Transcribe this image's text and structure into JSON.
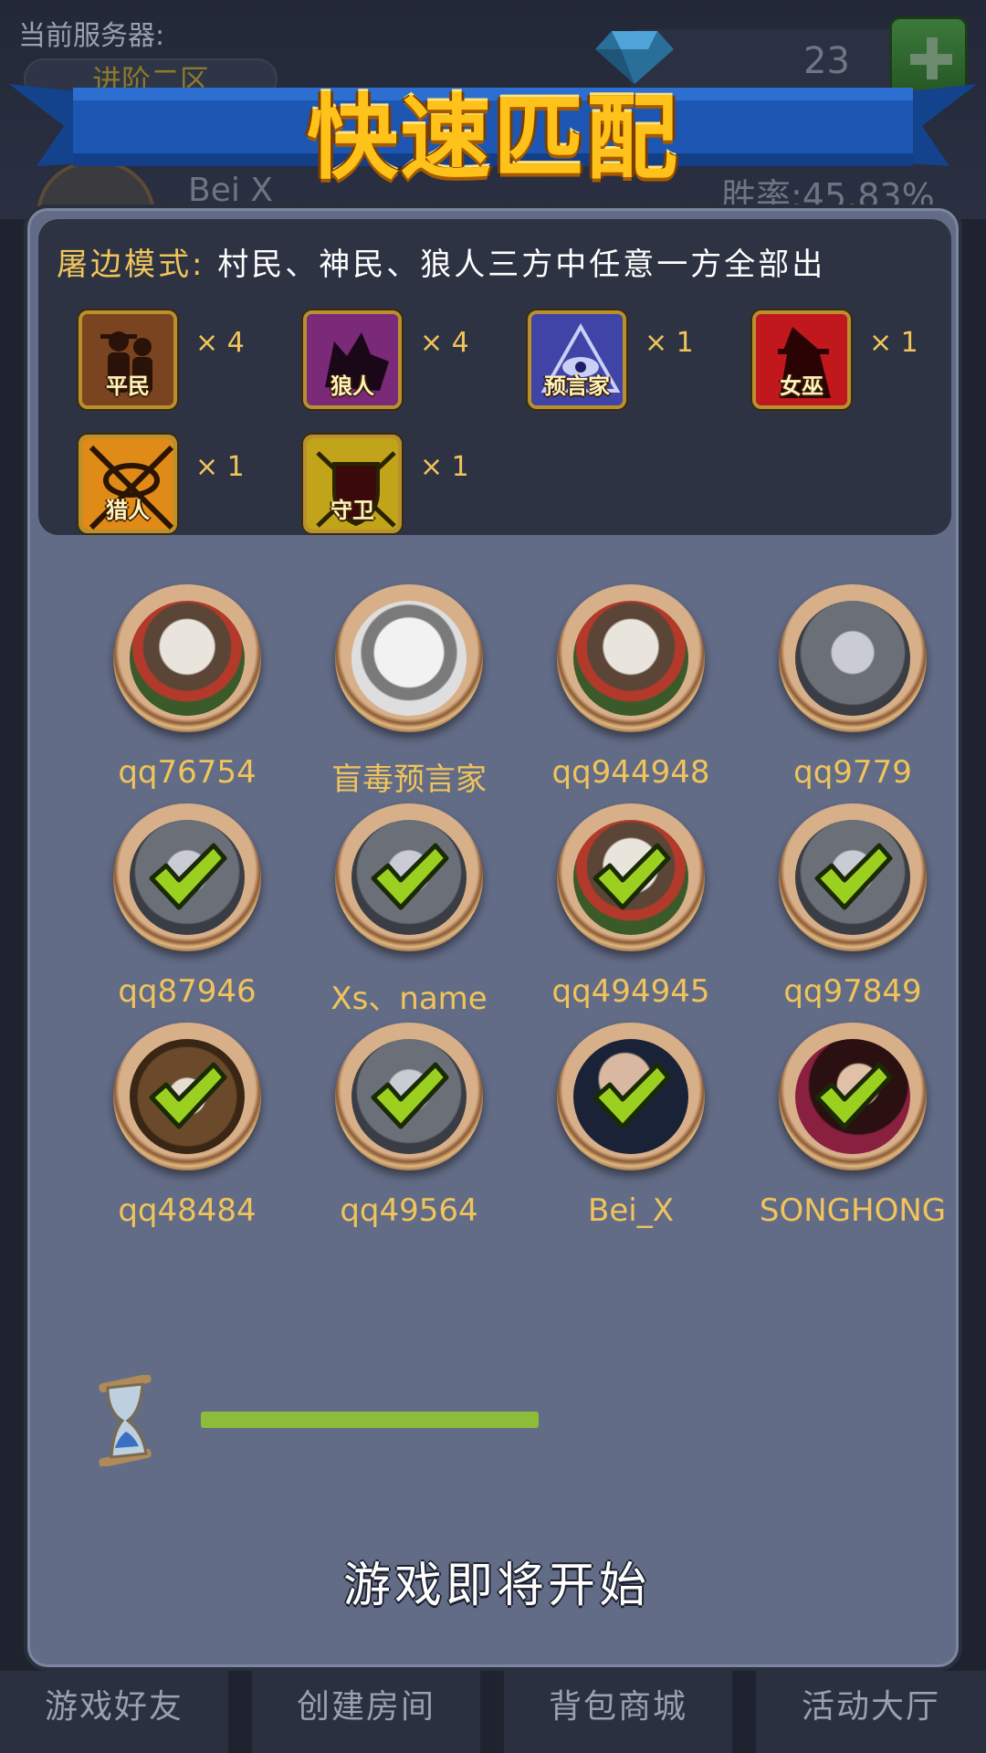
{
  "background": {
    "server_label": "当前服务器:",
    "server_name": "进阶二区",
    "gem_count": "23",
    "player_name": "Bei X",
    "win_rate": "胜率:45.83%"
  },
  "title": "快速匹配",
  "mode": {
    "title": "屠边模式:",
    "description": "村民、神民、狼人三方中任意一方全部出"
  },
  "roles": [
    {
      "label": "平民",
      "count": "× 4",
      "color": "#6b3a1a",
      "icon": "villagers-icon"
    },
    {
      "label": "狼人",
      "count": "× 4",
      "color": "#6a1f66",
      "icon": "werewolf-icon"
    },
    {
      "label": "预言家",
      "count": "× 1",
      "color": "#3b3f9a",
      "icon": "seer-eye-icon"
    },
    {
      "label": "女巫",
      "count": "× 1",
      "color": "#b3171b",
      "icon": "witch-icon"
    },
    {
      "label": "猎人",
      "count": "× 1",
      "color": "#d17a14",
      "icon": "hunter-icon"
    },
    {
      "label": "守卫",
      "count": "× 1",
      "color": "#b59a16",
      "icon": "guard-shield-icon"
    }
  ],
  "players": [
    {
      "name": "qq76754",
      "ready": false,
      "avatar": "husky-avatar"
    },
    {
      "name": "盲毒预言家",
      "ready": false,
      "avatar": "sketch-portrait-avatar"
    },
    {
      "name": "qq944948",
      "ready": false,
      "avatar": "husky-avatar"
    },
    {
      "name": "qq9779",
      "ready": false,
      "avatar": "wolf-avatar"
    },
    {
      "name": "qq87946",
      "ready": true,
      "avatar": "wolf-avatar"
    },
    {
      "name": "Xs、name",
      "ready": true,
      "avatar": "wolf-avatar"
    },
    {
      "name": "qq494945",
      "ready": true,
      "avatar": "husky-avatar"
    },
    {
      "name": "qq97849",
      "ready": true,
      "avatar": "wolf-avatar"
    },
    {
      "name": "qq48484",
      "ready": true,
      "avatar": "brown-wolf-avatar"
    },
    {
      "name": "qq49564",
      "ready": true,
      "avatar": "wolf-avatar"
    },
    {
      "name": "Bei_X",
      "ready": true,
      "avatar": "photo-man-avatar"
    },
    {
      "name": "SONGHONG",
      "ready": true,
      "avatar": "photo-woman-avatar"
    }
  ],
  "progress": {
    "fraction": 0.56
  },
  "start_message": "游戏即将开始",
  "tabs": [
    {
      "label": "游戏好友"
    },
    {
      "label": "创建房间"
    },
    {
      "label": "背包商城"
    },
    {
      "label": "活动大厅"
    }
  ],
  "colors": {
    "accent_gold": "#f0c45a",
    "panel": "#636c87",
    "progress": "#8bbd3a",
    "check": "#9bd020"
  }
}
